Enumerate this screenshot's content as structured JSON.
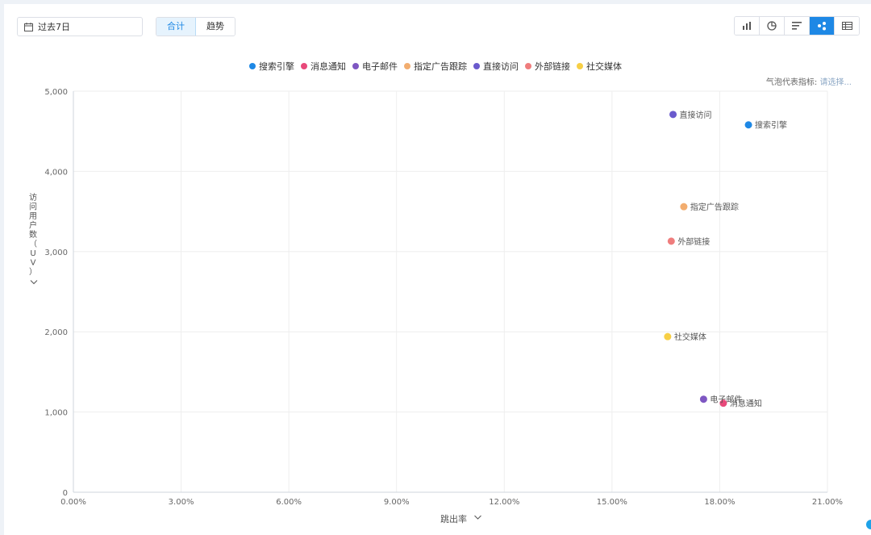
{
  "toolbar": {
    "date_range": "过去7日",
    "mode_tabs": [
      {
        "label": "合计",
        "active": true
      },
      {
        "label": "趋势",
        "active": false
      }
    ],
    "chart_type_icons": [
      {
        "name": "bar-chart-icon",
        "active": false
      },
      {
        "name": "pie-chart-icon",
        "active": false
      },
      {
        "name": "horizontal-bar-icon",
        "active": false
      },
      {
        "name": "bubble-chart-icon",
        "active": true
      },
      {
        "name": "table-icon",
        "active": false
      }
    ]
  },
  "bubble_metric": {
    "label": "气泡代表指标:",
    "placeholder": "请选择..."
  },
  "colors": {
    "accent": "#1e88e5",
    "grid": "#eeeeee"
  },
  "chart_data": {
    "type": "scatter",
    "xlabel": "跳出率",
    "ylabel": "访问用户数（UV）",
    "xlim": [
      0,
      21
    ],
    "ylim": [
      0,
      5000
    ],
    "x_ticks": [
      "0.00%",
      "3.00%",
      "6.00%",
      "9.00%",
      "12.00%",
      "15.00%",
      "18.00%",
      "21.00%"
    ],
    "y_ticks": [
      "0",
      "1,000",
      "2,000",
      "3,000",
      "4,000",
      "5,000"
    ],
    "legend_position": "top-center",
    "grid": true,
    "series": [
      {
        "name": "搜索引擎",
        "color": "#1e88e5",
        "x": 18.8,
        "y": 4580
      },
      {
        "name": "消息通知",
        "color": "#e8497a",
        "x": 18.1,
        "y": 1110
      },
      {
        "name": "电子邮件",
        "color": "#7e57c2",
        "x": 17.55,
        "y": 1160
      },
      {
        "name": "指定广告跟踪",
        "color": "#f2ad6f",
        "x": 17.0,
        "y": 3560
      },
      {
        "name": "直接访问",
        "color": "#6a5acd",
        "x": 16.7,
        "y": 4710
      },
      {
        "name": "外部链接",
        "color": "#ef7d7d",
        "x": 16.65,
        "y": 3130
      },
      {
        "name": "社交媒体",
        "color": "#f7cf45",
        "x": 16.55,
        "y": 1940
      }
    ]
  }
}
